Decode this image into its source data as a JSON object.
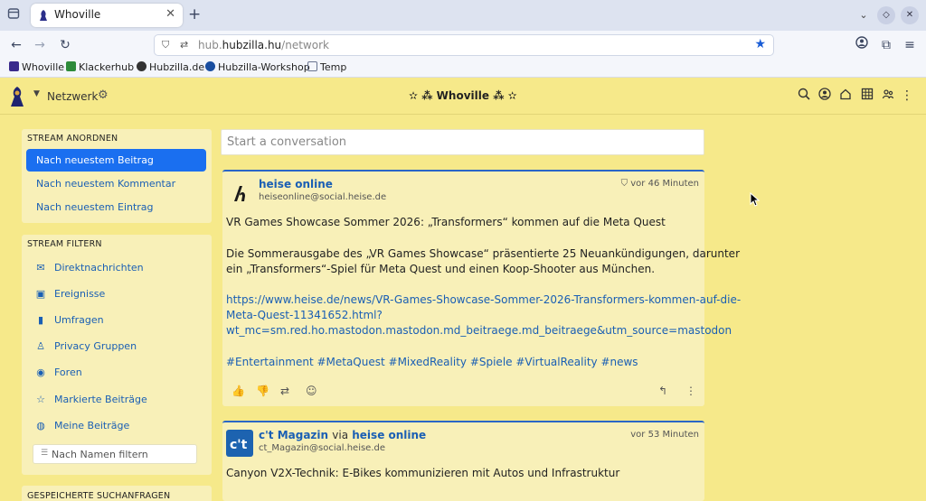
{
  "browser": {
    "tab_title": "Whoville",
    "url_prefix": "hub.",
    "url_domain": "hubzilla.hu",
    "url_path": "/network",
    "bookmarks": [
      {
        "label": "Whoville",
        "color": "#3a2a8c"
      },
      {
        "label": "Klackerhub",
        "color": "#2e8b3a"
      },
      {
        "label": "Hubzilla.de",
        "color": "#333333"
      },
      {
        "label": "Hubzilla-Workshop",
        "color": "#1a4ea0"
      },
      {
        "label": "Temp",
        "color": "#6a7590"
      }
    ]
  },
  "appbar": {
    "network_label": "Netzwerk",
    "site_title": "✫ ⁂ Whoville ⁂ ✫"
  },
  "sidebar": {
    "order_heading": "STREAM ANORDNEN",
    "order_items": [
      "Nach neuestem Beitrag",
      "Nach neuestem Kommentar",
      "Nach neuestem Eintrag"
    ],
    "filter_heading": "STREAM FILTERN",
    "filter_items": [
      {
        "label": "Direktnachrichten",
        "icon": "envelope-icon"
      },
      {
        "label": "Ereignisse",
        "icon": "calendar-icon"
      },
      {
        "label": "Umfragen",
        "icon": "bar-chart-icon"
      },
      {
        "label": "Privacy Gruppen",
        "icon": "person-icon"
      },
      {
        "label": "Foren",
        "icon": "forum-icon"
      },
      {
        "label": "Markierte Beiträge",
        "icon": "star-icon"
      },
      {
        "label": "Meine Beiträge",
        "icon": "user-circle-icon"
      }
    ],
    "name_filter_placeholder": "Nach Namen filtern",
    "saved_heading": "GESPEICHERTE SUCHANFRAGEN"
  },
  "composer": {
    "placeholder": "Start a conversation"
  },
  "posts": [
    {
      "author": "heise online",
      "handle": "heiseonline@social.heise.de",
      "time": "vor 46 Minuten",
      "title": "VR Games Showcase Sommer 2026: „Transformers“ kommen auf die Meta Quest",
      "body1": "Die Sommerausgabe des „VR Games Showcase“ präsentierte 25 Neuankündigungen, darunter",
      "body2": "ein „Transformers“-Spiel für Meta Quest und einen Koop-Shooter aus München.",
      "link1": "https://www.heise.de/news/VR-Games-Showcase-Sommer-2026-Transformers-kommen-auf-die-",
      "link2": "Meta-Quest-11341652.html?",
      "link3": "wt_mc=sm.red.ho.mastodon.mastodon.md_beitraege.md_beitraege&utm_source=mastodon",
      "hashtags": "#Entertainment #MetaQuest #MixedReality #Spiele #VirtualReality #news"
    },
    {
      "author": "c't Magazin",
      "via": "via",
      "via_author": "heise online",
      "handle": "ct_Magazin@social.heise.de",
      "time": "vor 53 Minuten",
      "title": "Canyon V2X-Technik: E-Bikes kommunizieren mit Autos und Infrastruktur"
    }
  ]
}
